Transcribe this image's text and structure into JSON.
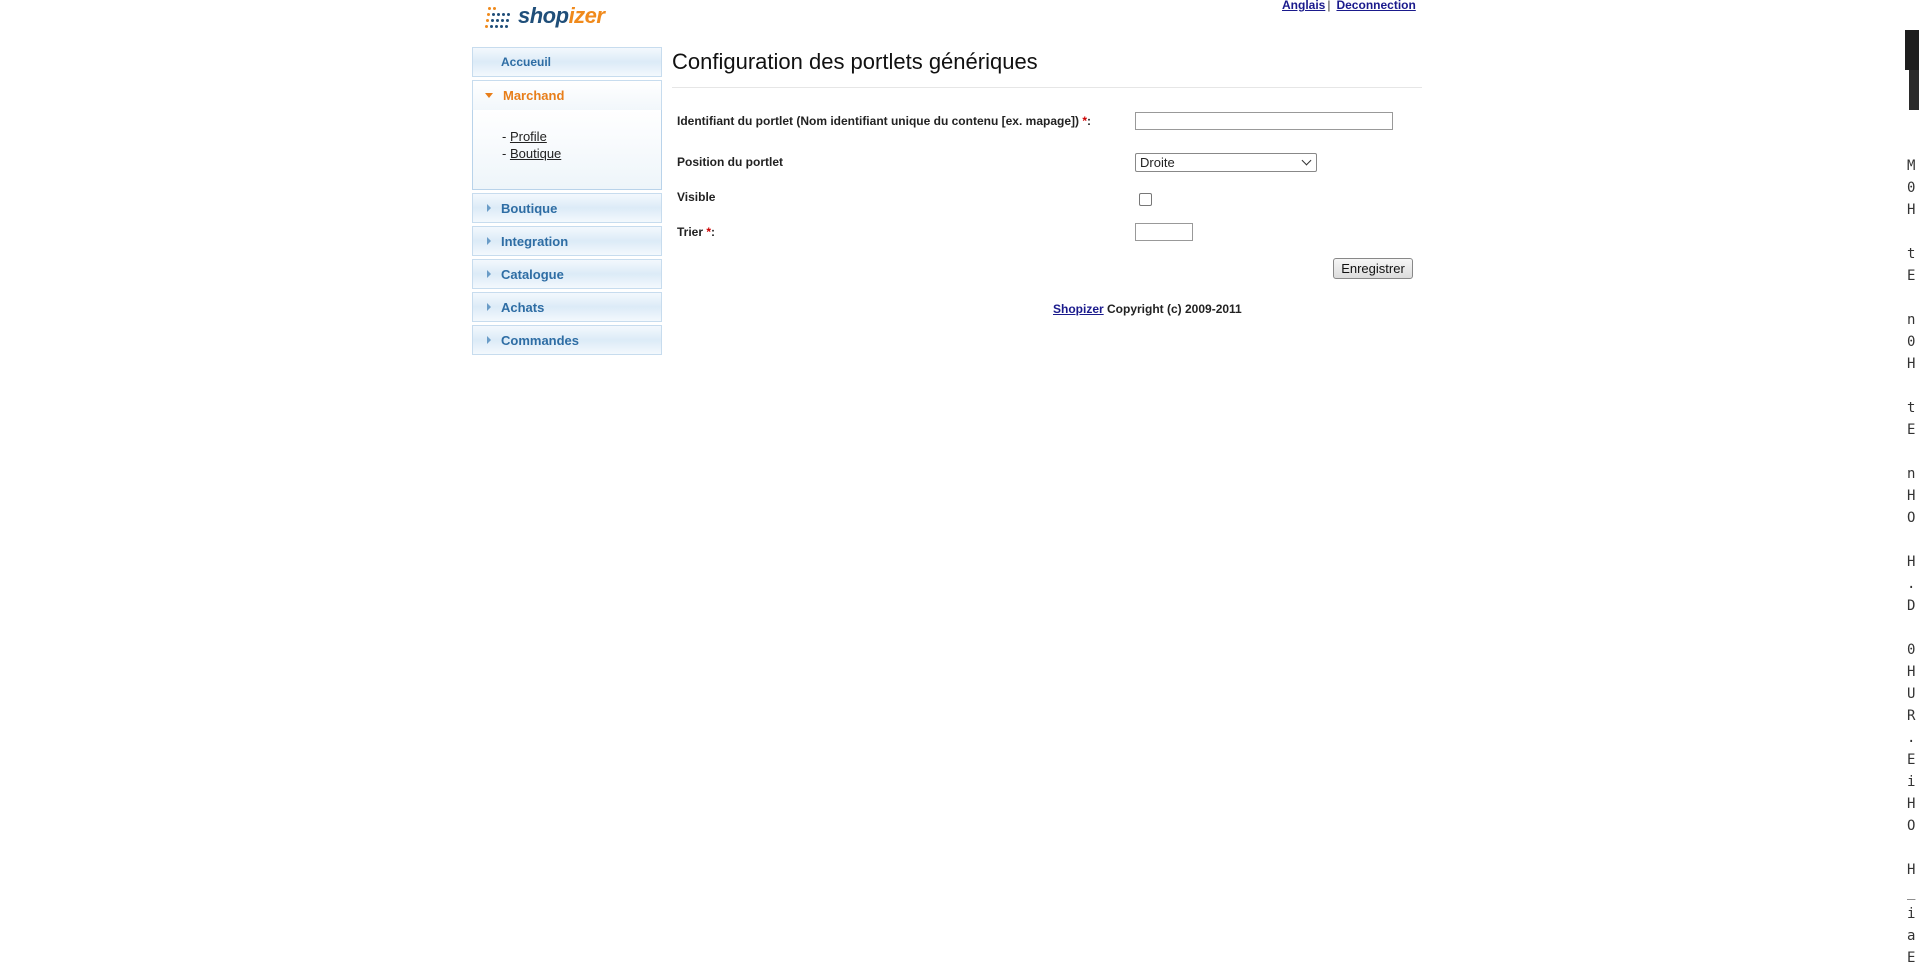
{
  "header": {
    "logo": {
      "part1": "shop",
      "part2": "izer"
    },
    "links": {
      "language": "Anglais",
      "separator": "|",
      "logout": "Deconnection"
    }
  },
  "sidebar": {
    "home": "Accueuil",
    "sections": [
      {
        "label": "Marchand",
        "open": true,
        "items": [
          "Profile",
          "Boutique"
        ]
      },
      {
        "label": "Boutique",
        "open": false
      },
      {
        "label": "Integration",
        "open": false
      },
      {
        "label": "Catalogue",
        "open": false
      },
      {
        "label": "Achats",
        "open": false
      },
      {
        "label": "Commandes",
        "open": false
      }
    ],
    "item_prefix": "- "
  },
  "main": {
    "title": "Configuration des portlets génériques",
    "form": {
      "identifier_label": "Identifiant du portlet (Nom identifiant unique du contenu [ex. mapage])",
      "identifier_value": "",
      "required_mark": "*",
      "colon": ":",
      "position_label": "Position du portlet",
      "position_value": "Droite",
      "visible_label": "Visible",
      "visible_checked": false,
      "sort_label": "Trier",
      "sort_value": "",
      "save_button": "Enregistrer"
    },
    "footer": {
      "link": "Shopizer",
      "text": "Copyright (c) 2009-2011"
    }
  },
  "terminal_edge": {
    "text": "M\n0\nH\n\nt\nE\n\nn\n0\nH\n\nt\nE\n\nn\nH\nO\n\nH\n.\nD\n\n0\nH\nU\nR\n.\nE\ni\nH\nO\n\nH\n_\ni\na\nE"
  },
  "colors": {
    "accent_orange": "#e87e1a",
    "link_blue": "#2e6da4",
    "header_link": "#1a1a8c",
    "required_red": "#cc0000"
  }
}
